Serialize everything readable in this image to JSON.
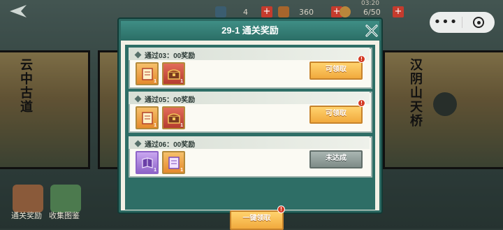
{
  "hud": {
    "stamina": "4",
    "gold": "360",
    "time": "03:20",
    "energy": "6/50",
    "plus": "+"
  },
  "capsule": {
    "more": "•••"
  },
  "background": {
    "card_left_title": "云中古道",
    "card_right_title": "汉阴山天桥",
    "bottom_left_label": "通关奖励",
    "bottom_right_label": "收集图鉴"
  },
  "dialog": {
    "title": "29-1 通关奖励",
    "rows": [
      {
        "title": "通过03：00奖励",
        "button": "可领取",
        "claimable": true,
        "items": [
          {
            "icon": "scroll-icon",
            "qty": "1",
            "color": "orange"
          },
          {
            "icon": "treasure-chest-icon",
            "qty": "1",
            "color": "red"
          }
        ]
      },
      {
        "title": "通过05：00奖励",
        "button": "可领取",
        "claimable": true,
        "items": [
          {
            "icon": "scroll-icon",
            "qty": "1",
            "color": "orange"
          },
          {
            "icon": "treasure-chest-icon",
            "qty": "1",
            "color": "red"
          }
        ]
      },
      {
        "title": "通过06：00奖励",
        "button": "未达成",
        "claimable": false,
        "items": [
          {
            "icon": "purple-book-icon",
            "qty": "1",
            "color": "purple"
          },
          {
            "icon": "scroll-icon",
            "qty": "1",
            "color": "orange"
          }
        ]
      }
    ],
    "one_click_button": "一键领取",
    "badge": "!"
  },
  "colors": {
    "header": "#2b6e66",
    "claim": "#f1a93d",
    "disabled": "#7e8c88",
    "badge": "#d43a24"
  }
}
